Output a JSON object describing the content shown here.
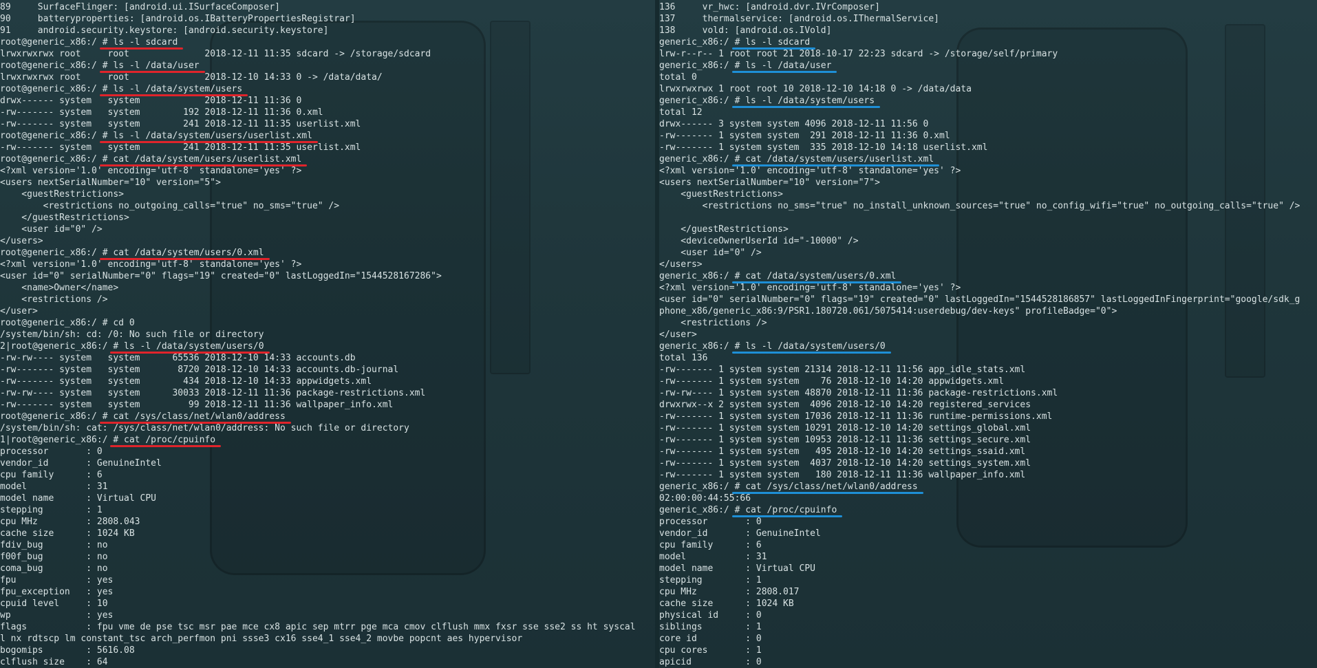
{
  "left_terminal": {
    "lines": [
      {
        "text": "89     SurfaceFlinger: [android.ui.ISurfaceComposer]"
      },
      {
        "text": "90     batteryproperties: [android.os.IBatteryPropertiesRegistrar]"
      },
      {
        "text": "91     android.security.keystore: [android.security.keystore]"
      },
      {
        "prompt": "root@generic_x86:/ ",
        "cmd": "# ls -l sdcard"
      },
      {
        "text": "lrwxrwxrwx root     root              2018-12-11 11:35 sdcard -> /storage/sdcard"
      },
      {
        "prompt": "root@generic_x86:/ ",
        "cmd": "# ls -l /data/user"
      },
      {
        "text": "lrwxrwxrwx root     root              2018-12-10 14:33 0 -> /data/data/"
      },
      {
        "prompt": "root@generic_x86:/ ",
        "cmd": "# ls -l /data/system/users"
      },
      {
        "text": "drwx------ system   system            2018-12-11 11:36 0"
      },
      {
        "text": "-rw------- system   system        192 2018-12-11 11:36 0.xml"
      },
      {
        "text": "-rw------- system   system        241 2018-12-11 11:35 userlist.xml"
      },
      {
        "prompt": "root@generic_x86:/ ",
        "cmd": "# ls -l /data/system/users/userlist.xml"
      },
      {
        "text": "-rw------- system   system        241 2018-12-11 11:35 userlist.xml"
      },
      {
        "prompt": "root@generic_x86:/ ",
        "cmd": "# cat /data/system/users/userlist.xml"
      },
      {
        "text": "<?xml version='1.0' encoding='utf-8' standalone='yes' ?>"
      },
      {
        "text": "<users nextSerialNumber=\"10\" version=\"5\">"
      },
      {
        "text": "    <guestRestrictions>"
      },
      {
        "text": "        <restrictions no_outgoing_calls=\"true\" no_sms=\"true\" />"
      },
      {
        "text": "    </guestRestrictions>"
      },
      {
        "text": "    <user id=\"0\" />"
      },
      {
        "text": "</users>"
      },
      {
        "prompt": "root@generic_x86:/ ",
        "cmd": "# cat /data/system/users/0.xml"
      },
      {
        "text": "<?xml version='1.0' encoding='utf-8' standalone='yes' ?>"
      },
      {
        "text": "<user id=\"0\" serialNumber=\"0\" flags=\"19\" created=\"0\" lastLoggedIn=\"1544528167286\">"
      },
      {
        "text": "    <name>Owner</name>"
      },
      {
        "text": "    <restrictions />"
      },
      {
        "text": "</user>"
      },
      {
        "text": "root@generic_x86:/ # cd 0"
      },
      {
        "text": "/system/bin/sh: cd: /0: No such file or directory"
      },
      {
        "prompt": "2|root@generic_x86:/ ",
        "cmd": "# ls -l /data/system/users/0"
      },
      {
        "text": "-rw-rw---- system   system      65536 2018-12-10 14:33 accounts.db"
      },
      {
        "text": "-rw------- system   system       8720 2018-12-10 14:33 accounts.db-journal"
      },
      {
        "text": "-rw------- system   system        434 2018-12-10 14:33 appwidgets.xml"
      },
      {
        "text": "-rw-rw---- system   system      30033 2018-12-11 11:36 package-restrictions.xml"
      },
      {
        "text": "-rw------- system   system         99 2018-12-11 11:36 wallpaper_info.xml"
      },
      {
        "prompt": "root@generic_x86:/ ",
        "cmd": "# cat /sys/class/net/wlan0/address"
      },
      {
        "text": "/system/bin/sh: cat: /sys/class/net/wlan0/address: No such file or directory"
      },
      {
        "prompt": "1|root@generic_x86:/ ",
        "cmd": "# cat /proc/cpuinfo"
      },
      {
        "text": "processor       : 0"
      },
      {
        "text": "vendor_id       : GenuineIntel"
      },
      {
        "text": "cpu family      : 6"
      },
      {
        "text": "model           : 31"
      },
      {
        "text": "model name      : Virtual CPU"
      },
      {
        "text": "stepping        : 1"
      },
      {
        "text": "cpu MHz         : 2808.043"
      },
      {
        "text": "cache size      : 1024 KB"
      },
      {
        "text": "fdiv_bug        : no"
      },
      {
        "text": "f00f_bug        : no"
      },
      {
        "text": "coma_bug        : no"
      },
      {
        "text": "fpu             : yes"
      },
      {
        "text": "fpu_exception   : yes"
      },
      {
        "text": "cpuid level     : 10"
      },
      {
        "text": "wp              : yes"
      },
      {
        "text": "flags           : fpu vme de pse tsc msr pae mce cx8 apic sep mtrr pge mca cmov clflush mmx fxsr sse sse2 ss ht syscal"
      },
      {
        "text": "l nx rdtscp lm constant_tsc arch_perfmon pni ssse3 cx16 sse4_1 sse4_2 movbe popcnt aes hypervisor"
      },
      {
        "text": "bogomips        : 5616.08"
      },
      {
        "text": "clflush size    : 64"
      }
    ]
  },
  "right_terminal": {
    "lines": [
      {
        "text": "136     vr_hwc: [android.dvr.IVrComposer]"
      },
      {
        "text": "137     thermalservice: [android.os.IThermalService]"
      },
      {
        "text": "138     vold: [android.os.IVold]"
      },
      {
        "prompt": "generic_x86:/ ",
        "cmd": "# ls -l sdcard"
      },
      {
        "text": "lrw-r--r-- 1 root root 21 2018-10-17 22:23 sdcard -> /storage/self/primary"
      },
      {
        "prompt": "generic_x86:/ ",
        "cmd": "# ls -l /data/user"
      },
      {
        "text": "total 0"
      },
      {
        "text": "lrwxrwxrwx 1 root root 10 2018-12-10 14:18 0 -> /data/data"
      },
      {
        "prompt": "generic_x86:/ ",
        "cmd": "# ls -l /data/system/users"
      },
      {
        "text": "total 12"
      },
      {
        "text": "drwx------ 3 system system 4096 2018-12-11 11:56 0"
      },
      {
        "text": "-rw------- 1 system system  291 2018-12-11 11:36 0.xml"
      },
      {
        "text": "-rw------- 1 system system  335 2018-12-10 14:18 userlist.xml"
      },
      {
        "prompt": "generic_x86:/ ",
        "cmd": "# cat /data/system/users/userlist.xml"
      },
      {
        "text": "<?xml version='1.0' encoding='utf-8' standalone='yes' ?>"
      },
      {
        "text": "<users nextSerialNumber=\"10\" version=\"7\">"
      },
      {
        "text": "    <guestRestrictions>"
      },
      {
        "text": "        <restrictions no_sms=\"true\" no_install_unknown_sources=\"true\" no_config_wifi=\"true\" no_outgoing_calls=\"true\" />"
      },
      {
        "text": ""
      },
      {
        "text": "    </guestRestrictions>"
      },
      {
        "text": "    <deviceOwnerUserId id=\"-10000\" />"
      },
      {
        "text": "    <user id=\"0\" />"
      },
      {
        "text": "</users>"
      },
      {
        "prompt": "generic_x86:/ ",
        "cmd": "# cat /data/system/users/0.xml"
      },
      {
        "text": "<?xml version='1.0' encoding='utf-8' standalone='yes' ?>"
      },
      {
        "text": "<user id=\"0\" serialNumber=\"0\" flags=\"19\" created=\"0\" lastLoggedIn=\"1544528186857\" lastLoggedInFingerprint=\"google/sdk_g"
      },
      {
        "text": "phone_x86/generic_x86:9/PSR1.180720.061/5075414:userdebug/dev-keys\" profileBadge=\"0\">"
      },
      {
        "text": "    <restrictions />"
      },
      {
        "text": "</user>"
      },
      {
        "prompt": "generic_x86:/ ",
        "cmd": "# ls -l /data/system/users/0"
      },
      {
        "text": "total 136"
      },
      {
        "text": "-rw------- 1 system system 21314 2018-12-11 11:56 app_idle_stats.xml"
      },
      {
        "text": "-rw------- 1 system system    76 2018-12-10 14:20 appwidgets.xml"
      },
      {
        "text": "-rw-rw---- 1 system system 48870 2018-12-11 11:36 package-restrictions.xml"
      },
      {
        "text": "drwxrwx--x 2 system system  4096 2018-12-10 14:20 registered_services"
      },
      {
        "text": "-rw------- 1 system system 17036 2018-12-11 11:36 runtime-permissions.xml"
      },
      {
        "text": "-rw------- 1 system system 10291 2018-12-10 14:20 settings_global.xml"
      },
      {
        "text": "-rw------- 1 system system 10953 2018-12-11 11:36 settings_secure.xml"
      },
      {
        "text": "-rw------- 1 system system   495 2018-12-10 14:20 settings_ssaid.xml"
      },
      {
        "text": "-rw------- 1 system system  4037 2018-12-10 14:20 settings_system.xml"
      },
      {
        "text": "-rw------- 1 system system   180 2018-12-11 11:36 wallpaper_info.xml"
      },
      {
        "prompt": "generic_x86:/ ",
        "cmd": "# cat /sys/class/net/wlan0/address"
      },
      {
        "text": "02:00:00:44:55:66"
      },
      {
        "prompt": "generic_x86:/ ",
        "cmd": "# cat /proc/cpuinfo"
      },
      {
        "text": "processor       : 0"
      },
      {
        "text": "vendor_id       : GenuineIntel"
      },
      {
        "text": "cpu family      : 6"
      },
      {
        "text": "model           : 31"
      },
      {
        "text": "model name      : Virtual CPU"
      },
      {
        "text": "stepping        : 1"
      },
      {
        "text": "cpu MHz         : 2808.017"
      },
      {
        "text": "cache size      : 1024 KB"
      },
      {
        "text": "physical id     : 0"
      },
      {
        "text": "siblings        : 1"
      },
      {
        "text": "core id         : 0"
      },
      {
        "text": "cpu cores       : 1"
      },
      {
        "text": "apicid          : 0"
      }
    ]
  },
  "colors": {
    "highlight_left": "#e0242b",
    "highlight_right": "#1e8fd6",
    "text": "#d8e2e3"
  },
  "icons": [
    "power-icon",
    "volume-up-icon",
    "volume-down-icon",
    "rotate-icon",
    "rotate-icon",
    "camera-icon",
    "zoom-icon",
    "back-icon",
    "home-icon",
    "overview-icon",
    "more-icon"
  ]
}
